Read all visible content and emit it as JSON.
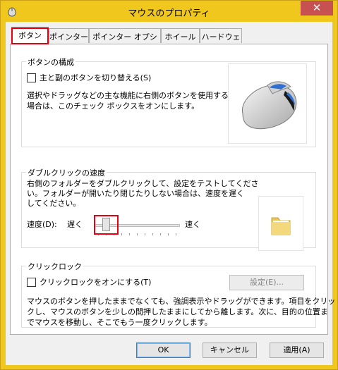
{
  "window": {
    "title": "マウスのプロパティ",
    "close_glyph": "✕"
  },
  "tabs": [
    {
      "label": "ボタン",
      "active": true
    },
    {
      "label": "ポインター",
      "active": false
    },
    {
      "label": "ポインター オプション",
      "active": false
    },
    {
      "label": "ホイール",
      "active": false
    },
    {
      "label": "ハードウェア",
      "active": false
    }
  ],
  "button_config": {
    "group_label": "ボタンの構成",
    "checkbox_label": "主と副のボタンを切り替える(S)",
    "checked": false,
    "desc_line1": "選択やドラッグなどの主な機能に右側のボタンを使用する",
    "desc_line2": "場合は、このチェック ボックスをオンにします。"
  },
  "double_click": {
    "group_label": "ダブルクリックの速度",
    "desc_line1": "右側のフォルダーをダブルクリックして、設定をテストしてくださ",
    "desc_line2": "い。フォルダーが開いたり閉じたりしない場合は、速度を遅く",
    "desc_line3": "してください。",
    "speed_label": "速度(D):",
    "slow_label": "遅く",
    "fast_label": "速く",
    "speed_level": 0.1
  },
  "click_lock": {
    "group_label": "クリックロック",
    "checkbox_label": "クリックロックをオンにする(T)",
    "checked": false,
    "settings_button": "設定(E)...",
    "desc_line1": "マウスのボタンを押したままでなくても、強調表示やドラッグができます。項目をクリッ",
    "desc_line2": "クし、マウスのボタンを少しの間押したままにしてから離します。次に、目的の位置ま",
    "desc_line3": "でマウスを移動し、そこでもう一度クリックします。"
  },
  "footer": {
    "ok": "OK",
    "cancel": "キャンセル",
    "apply": "適用(A)"
  },
  "colors": {
    "title_bar": "#f0c81d",
    "close_button": "#c75050",
    "highlight": "#e60012"
  }
}
